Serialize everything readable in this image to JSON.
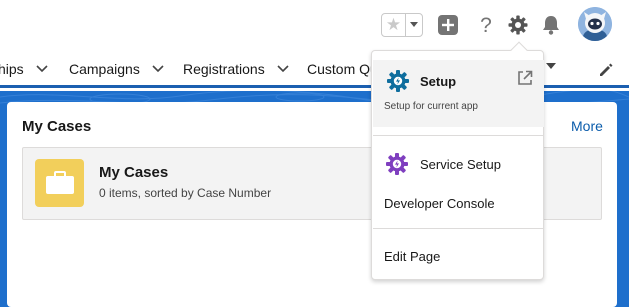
{
  "header": {
    "favorites_icon": "star-icon",
    "favorites_menu_icon": "caret-down-icon",
    "global_actions_icon": "plus-icon",
    "help_icon": "question-icon",
    "setup_icon": "gear-icon",
    "notifications_icon": "bell-icon",
    "avatar_icon": "astro-avatar"
  },
  "nav": {
    "items": [
      {
        "label": "hips"
      },
      {
        "label": "Campaigns"
      },
      {
        "label": "Registrations"
      },
      {
        "label": "Custom Qu"
      }
    ],
    "edit_icon": "pencil-icon"
  },
  "card": {
    "title": "My Cases",
    "more_link": "More",
    "list": {
      "title": "My Cases",
      "subtitle": "0 items, sorted by Case Number",
      "icon": "briefcase-icon"
    }
  },
  "setup_menu": {
    "setup_label": "Setup",
    "setup_subtitle": "Setup for current app",
    "service_setup_label": "Service Setup",
    "developer_console_label": "Developer Console",
    "edit_page_label": "Edit Page"
  },
  "colors": {
    "brand_blue": "#1e6fcc",
    "link_blue": "#0b5cab",
    "cases_yellow": "#f2cf5b",
    "setup_icon_blue": "#0f6e9e",
    "service_icon_purple": "#7f3fbf"
  }
}
